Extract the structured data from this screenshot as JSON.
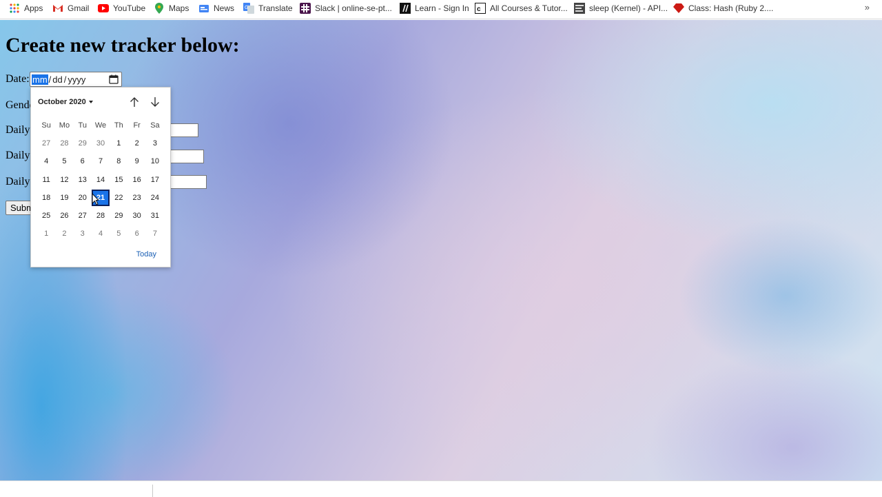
{
  "bookmarks": [
    {
      "label": "Apps",
      "icon": "apps-grid-icon"
    },
    {
      "label": "Gmail",
      "icon": "gmail-icon"
    },
    {
      "label": "YouTube",
      "icon": "youtube-icon"
    },
    {
      "label": "Maps",
      "icon": "maps-pin-icon"
    },
    {
      "label": "News",
      "icon": "news-icon"
    },
    {
      "label": "Translate",
      "icon": "translate-icon"
    },
    {
      "label": "Slack | online-se-pt...",
      "icon": "slack-icon"
    },
    {
      "label": "Learn - Sign In",
      "icon": "learn-icon"
    },
    {
      "label": "All Courses & Tutor...",
      "icon": "courses-icon"
    },
    {
      "label": "sleep (Kernel) - API...",
      "icon": "api-doc-icon"
    },
    {
      "label": "Class: Hash (Ruby 2....",
      "icon": "ruby-icon"
    }
  ],
  "bookmarks_more": "»",
  "page": {
    "heading": "Create new tracker below:",
    "date_label": "Date:",
    "date_segments": {
      "mm": "mm",
      "sep1": "/",
      "dd": "dd",
      "sep2": "/",
      "yyyy": "yyyy"
    },
    "gender_label": "Gende",
    "daily1_label": "Daily",
    "daily2_label": "Daily",
    "daily3_label": "Daily",
    "submit_label": "Subm"
  },
  "date_picker": {
    "month_label": "October 2020",
    "weekdays": [
      "Su",
      "Mo",
      "Tu",
      "We",
      "Th",
      "Fr",
      "Sa"
    ],
    "weeks": [
      [
        {
          "d": "27",
          "o": true
        },
        {
          "d": "28",
          "o": true
        },
        {
          "d": "29",
          "o": true
        },
        {
          "d": "30",
          "o": true
        },
        {
          "d": "1"
        },
        {
          "d": "2"
        },
        {
          "d": "3"
        }
      ],
      [
        {
          "d": "4"
        },
        {
          "d": "5"
        },
        {
          "d": "6"
        },
        {
          "d": "7"
        },
        {
          "d": "8"
        },
        {
          "d": "9"
        },
        {
          "d": "10"
        }
      ],
      [
        {
          "d": "11"
        },
        {
          "d": "12"
        },
        {
          "d": "13"
        },
        {
          "d": "14"
        },
        {
          "d": "15"
        },
        {
          "d": "16"
        },
        {
          "d": "17"
        }
      ],
      [
        {
          "d": "18"
        },
        {
          "d": "19"
        },
        {
          "d": "20"
        },
        {
          "d": "21",
          "sel": true
        },
        {
          "d": "22"
        },
        {
          "d": "23"
        },
        {
          "d": "24"
        }
      ],
      [
        {
          "d": "25"
        },
        {
          "d": "26"
        },
        {
          "d": "27"
        },
        {
          "d": "28"
        },
        {
          "d": "29"
        },
        {
          "d": "30"
        },
        {
          "d": "31"
        }
      ],
      [
        {
          "d": "1",
          "o": true
        },
        {
          "d": "2",
          "o": true
        },
        {
          "d": "3",
          "o": true
        },
        {
          "d": "4",
          "o": true
        },
        {
          "d": "5",
          "o": true
        },
        {
          "d": "6",
          "o": true
        },
        {
          "d": "7",
          "o": true
        }
      ]
    ],
    "today_label": "Today"
  },
  "colors": {
    "selected_day": "#1a73e8",
    "today_link": "#1a5fb4",
    "bg_blue": "#86c7ea",
    "bg_purple": "#a7a9dd",
    "bg_pink": "#dccfe3"
  }
}
